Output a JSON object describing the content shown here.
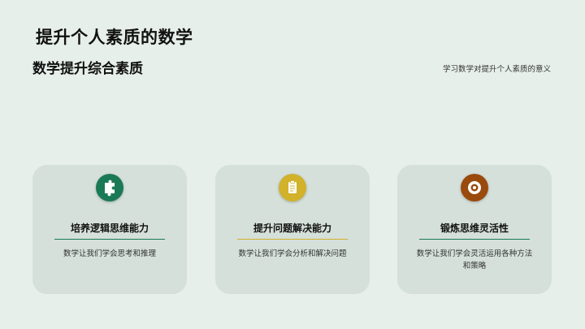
{
  "slide": {
    "title": "提升个人素质的数学",
    "subtitle": "数学提升综合素质",
    "note": "学习数学对提升个人素质的意义"
  },
  "cards": [
    {
      "title": "培养逻辑思维能力",
      "description": "数学让我们学会思考和推理",
      "icon": "puzzle-icon",
      "accent": "#1a7a55"
    },
    {
      "title": "提升问题解决能力",
      "description": "数学让我们学会分析和解决问题",
      "icon": "clipboard-icon",
      "accent": "#d1b22a"
    },
    {
      "title": "锻炼思维灵活性",
      "description": "数学让我们学会灵活运用各种方法和策略",
      "icon": "target-icon",
      "accent": "#9a4a0c"
    }
  ],
  "colors": {
    "background": "#e6efea",
    "card": "#d5e0da"
  }
}
